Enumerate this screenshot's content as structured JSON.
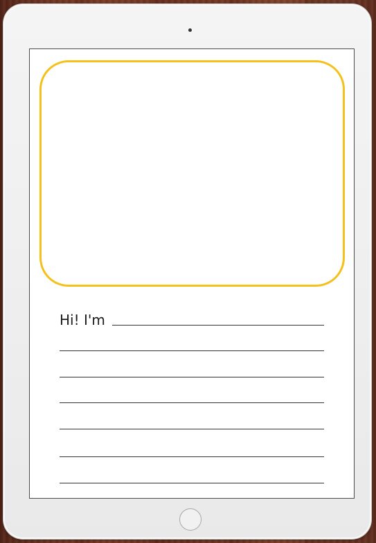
{
  "worksheet": {
    "intro_label": "Hi! I'm",
    "blank_lines": 6
  },
  "colors": {
    "frame_accent": "#f5c01a",
    "tablet_body": "#efefef",
    "screen": "#ffffff",
    "wood": "#6b3120"
  },
  "icons": {
    "camera": "front-camera-icon",
    "home": "home-button-icon"
  }
}
